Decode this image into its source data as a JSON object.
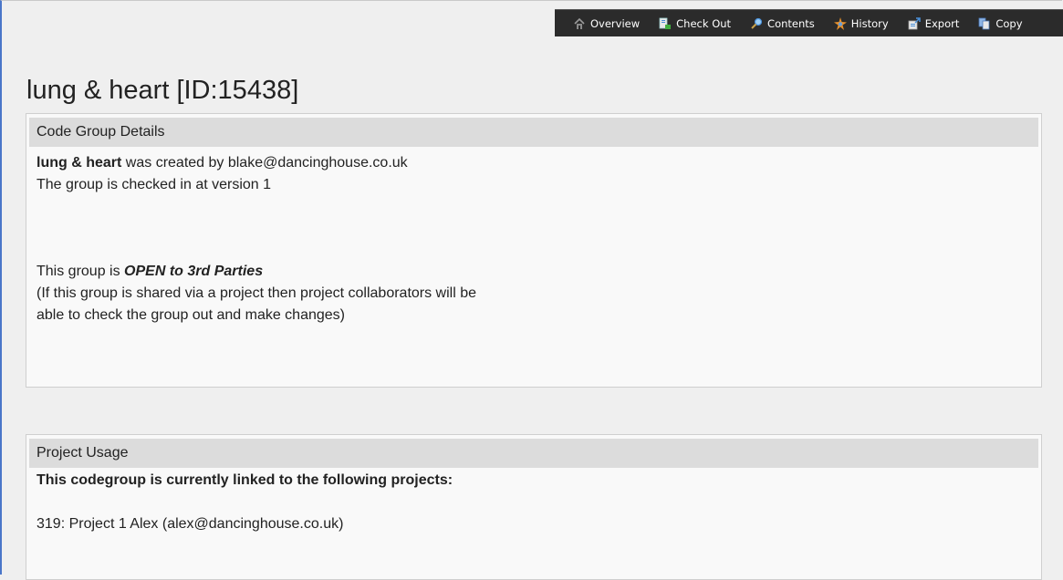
{
  "toolbar": {
    "items": [
      {
        "label": "Overview",
        "icon": "home-icon"
      },
      {
        "label": "Check Out",
        "icon": "checkout-icon"
      },
      {
        "label": "Contents",
        "icon": "search-icon"
      },
      {
        "label": "History",
        "icon": "history-icon"
      },
      {
        "label": "Export",
        "icon": "export-icon"
      },
      {
        "label": "Copy",
        "icon": "copy-icon"
      }
    ]
  },
  "page": {
    "title": "lung & heart [ID:15438]"
  },
  "details": {
    "header": "Code Group Details",
    "group_name": "lung & heart",
    "created_by_text": " was created by blake@dancinghouse.co.uk",
    "version_text": "The group is checked in at version 1",
    "open_prefix": "This group is ",
    "open_status": "OPEN to 3rd Parties",
    "open_note_1": "(If this group is shared via a project then project collaborators will be",
    "open_note_2": "able to check the group out and make changes)"
  },
  "usage": {
    "header": "Project Usage",
    "intro": "This codegroup is currently linked to the following projects:",
    "projects": [
      "319: Project 1 Alex (alex@dancinghouse.co.uk)"
    ]
  }
}
